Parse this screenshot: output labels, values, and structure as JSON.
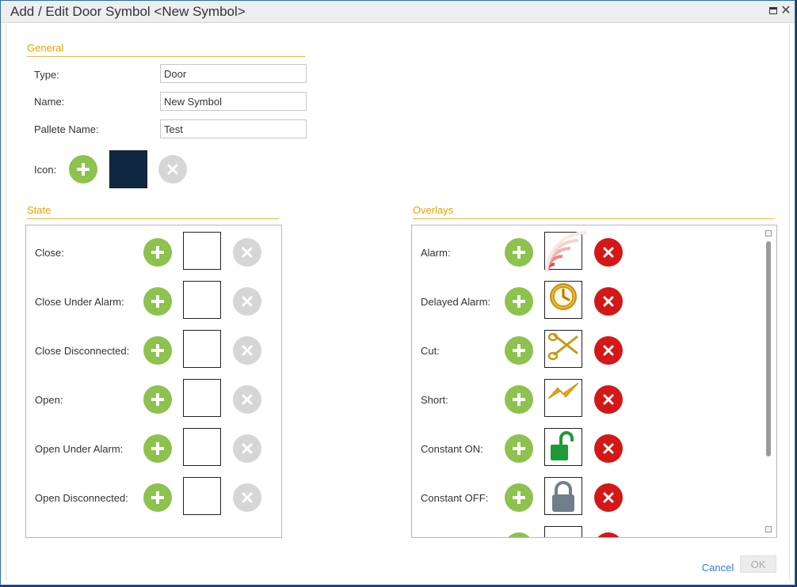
{
  "window": {
    "title": "Add / Edit Door Symbol <New Symbol>"
  },
  "general": {
    "title": "General",
    "type_label": "Type:",
    "type_value": "Door",
    "name_label": "Name:",
    "name_value": "New Symbol",
    "palette_label": "Pallete Name:",
    "palette_value": "Test",
    "icon_label": "Icon:",
    "icon_color": "#102842"
  },
  "state": {
    "title": "State",
    "rows": [
      {
        "label": "Close:"
      },
      {
        "label": "Close Under Alarm:"
      },
      {
        "label": "Close Disconnected:"
      },
      {
        "label": "Open:"
      },
      {
        "label": "Open Under Alarm:"
      },
      {
        "label": "Open Disconnected:"
      }
    ]
  },
  "overlays": {
    "title": "Overlays",
    "rows": [
      {
        "label": "Alarm:",
        "icon": "alarm-waves-icon"
      },
      {
        "label": "Delayed Alarm:",
        "icon": "clock-icon"
      },
      {
        "label": "Cut:",
        "icon": "scissors-icon"
      },
      {
        "label": "Short:",
        "icon": "lightning-icon"
      },
      {
        "label": "Constant ON:",
        "icon": "unlocked-padlock-icon"
      },
      {
        "label": "Constant OFF:",
        "icon": "locked-padlock-icon"
      }
    ]
  },
  "footer": {
    "cancel_label": "Cancel",
    "ok_label": "OK"
  },
  "colors": {
    "accent": "#e8a200",
    "add_green": "#8cc24d",
    "remove_red": "#d41717",
    "disabled_gray": "#d6d6d6"
  }
}
